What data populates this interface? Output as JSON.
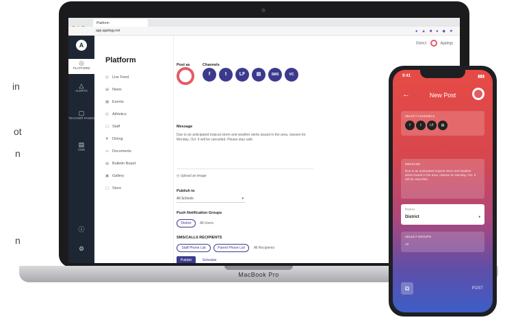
{
  "edge_text": [
    "in",
    "ot",
    "n",
    "n"
  ],
  "browser": {
    "tab_title": "Platform",
    "url": "app.apptegy.net",
    "extensions": "● ▲ ■ ● ◆ ★"
  },
  "header": {
    "district": "District",
    "user": "Apptegy"
  },
  "rail": {
    "logo": "A",
    "items": [
      {
        "label": "PLATFORM",
        "icon": "◎"
      },
      {
        "label": "ALERTS",
        "icon": "△"
      },
      {
        "label": "TEACHER PAGES",
        "icon": "▢"
      },
      {
        "label": "CMS",
        "icon": "▤"
      },
      {
        "label": "",
        "icon": "ⓘ"
      },
      {
        "label": "",
        "icon": "⚙"
      }
    ]
  },
  "sidebar": {
    "title": "Platform",
    "items": [
      {
        "label": "Live Feed",
        "icon": "◎"
      },
      {
        "label": "News",
        "icon": "▤"
      },
      {
        "label": "Events",
        "icon": "▦"
      },
      {
        "label": "Athletics",
        "icon": "◎"
      },
      {
        "label": "Staff",
        "icon": "▢"
      },
      {
        "label": "Dining",
        "icon": "❦"
      },
      {
        "label": "Documents",
        "icon": "▭"
      },
      {
        "label": "Bulletin Board",
        "icon": "▤"
      },
      {
        "label": "Gallery",
        "icon": "▣"
      },
      {
        "label": "Store",
        "icon": "▢"
      }
    ]
  },
  "form": {
    "post_as_label": "Post as",
    "channels_label": "Channels",
    "channels": [
      "f",
      "t",
      "LF",
      "▤",
      "SMS",
      "VC"
    ],
    "message_label": "Message",
    "message_text": "Due to an anticipated tropical storm and weather alerts issued in the area, classes for Monday, Oct. 6 will be cancelled. Please stay safe.",
    "attachment_label": "Upload an image",
    "publish_label": "Publish to",
    "publish_value": "All Schools",
    "groups_label": "Push Notification Groups",
    "groups": [
      "District",
      "All Users"
    ],
    "sms_label": "SMS/CALLS RECIPIENTS",
    "sms_recipients": [
      "Staff Phone List",
      "Parent Phone List",
      "All Recipients"
    ],
    "submit_label": "Publish",
    "schedule_label": "Schedule"
  },
  "laptop_brand": "MacBook Pro",
  "phone": {
    "time": "9:41",
    "status_right": "▮▮▮",
    "back": "←",
    "title": "New Post",
    "channels_label": "SELECT CHANNELS",
    "channels": [
      "f",
      "t",
      "LF",
      "▤"
    ],
    "message_label": "MESSAGE",
    "message_text": "Due to an anticipated tropical storm and weather alerts issued in the area, classes for Monday, Oct. 6 will be cancelled.",
    "publish_label": "Post to",
    "publish_value": "District",
    "groups_label": "SELECT GROUPS",
    "groups_value": "All",
    "clip": "⧉",
    "post": "POST"
  }
}
